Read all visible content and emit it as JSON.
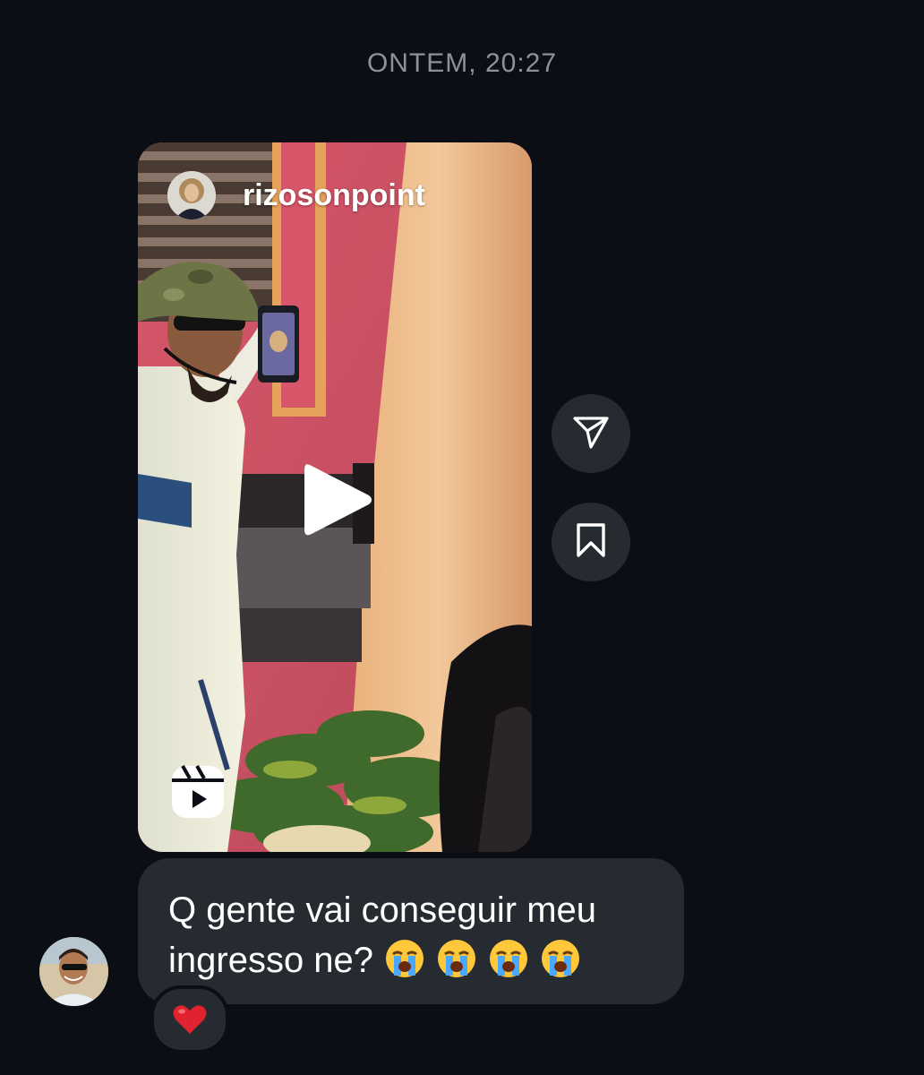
{
  "conversation": {
    "timestamp": "ONTEM, 20:27"
  },
  "shared_reel": {
    "username": "rizosonpoint",
    "avatar_icon": "profile-avatar",
    "play_icon": "play-icon",
    "reels_icon": "reels-icon"
  },
  "actions": {
    "share_icon": "paper-plane-icon",
    "save_icon": "bookmark-icon"
  },
  "message": {
    "text": "Q gente vai conseguir meu ingresso ne?",
    "emojis": [
      "loudly-crying-face",
      "loudly-crying-face",
      "loudly-crying-face",
      "loudly-crying-face"
    ],
    "reaction": "red-heart"
  },
  "colors": {
    "background": "#0b0e14",
    "bubble": "#262a31",
    "timestamp_text": "#8e9196",
    "heart": "#e0232e"
  }
}
